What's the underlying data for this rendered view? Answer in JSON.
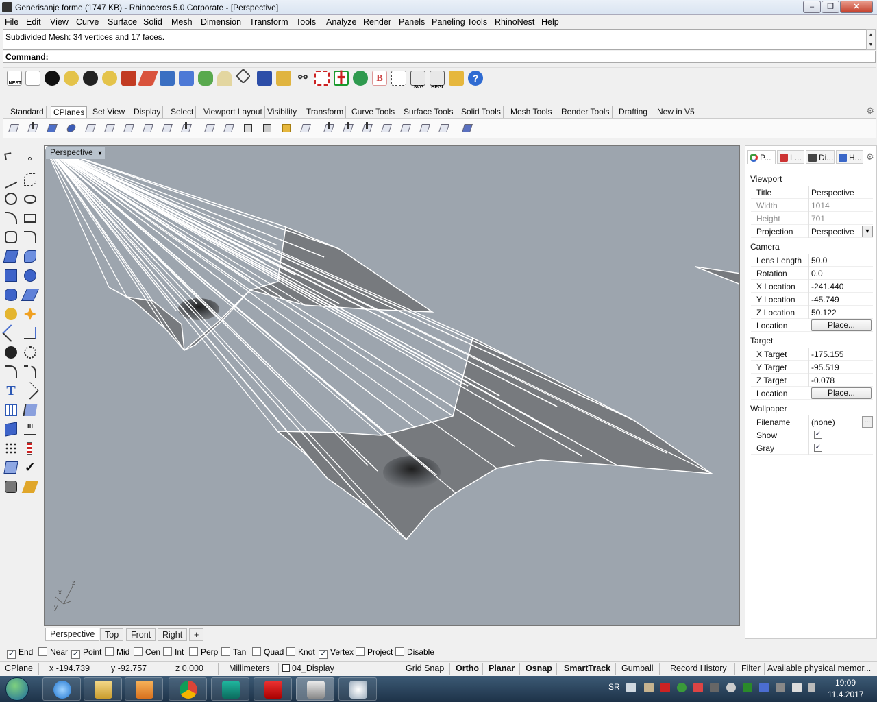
{
  "window": {
    "title": "Generisanje forme (1747 KB) - Rhinoceros  5.0 Corporate - [Perspective]",
    "controls": [
      "–",
      "❐",
      "✕"
    ]
  },
  "menu": [
    "File",
    "Edit",
    "View",
    "Curve",
    "Surface",
    "Solid",
    "Mesh",
    "Dimension",
    "Transform",
    "Tools",
    "Analyze",
    "Render",
    "Panels",
    "Paneling Tools",
    "RhinoNest",
    "Help"
  ],
  "command": {
    "history": "Subdivided Mesh: 34 vertices and 17 faces.",
    "prompt_label": "Command:"
  },
  "toolbar_top": {
    "nest_label": "NEST",
    "svg_label": "SVG",
    "hpgl_label": "HPGL",
    "b_label": "B",
    "help_label": "?"
  },
  "toolbar_tabs": [
    "Standard",
    "CPlanes",
    "Set View",
    "Display",
    "Select",
    "Viewport Layout",
    "Visibility",
    "Transform",
    "Curve Tools",
    "Surface Tools",
    "Solid Tools",
    "Mesh Tools",
    "Render Tools",
    "Drafting",
    "New in V5"
  ],
  "viewport": {
    "title": "Perspective",
    "axis_labels": {
      "x": "x",
      "y": "y",
      "z": "z"
    },
    "tabs": [
      "Perspective",
      "Top",
      "Front",
      "Right"
    ],
    "add_tab": "+",
    "background": "#9da5ae",
    "mesh_color": "#777a7e",
    "edge_color": "#ffffff"
  },
  "panel": {
    "tabs": [
      "P...",
      "L...",
      "Di...",
      "H..."
    ],
    "viewport_section": "Viewport",
    "viewport_rows": [
      {
        "key": "Title",
        "value": "Perspective"
      },
      {
        "key": "Width",
        "value": "1014"
      },
      {
        "key": "Height",
        "value": "701"
      },
      {
        "key": "Projection",
        "value": "Perspective"
      }
    ],
    "camera_section": "Camera",
    "camera_rows": [
      {
        "key": "Lens Length",
        "value": "50.0"
      },
      {
        "key": "Rotation",
        "value": "0.0"
      },
      {
        "key": "X Location",
        "value": "-241.440"
      },
      {
        "key": "Y Location",
        "value": "-45.749"
      },
      {
        "key": "Z Location",
        "value": "50.122"
      },
      {
        "key": "Location",
        "value": "Place..."
      }
    ],
    "target_section": "Target",
    "target_rows": [
      {
        "key": "X Target",
        "value": "-175.155"
      },
      {
        "key": "Y Target",
        "value": "-95.519"
      },
      {
        "key": "Z Target",
        "value": "-0.078"
      },
      {
        "key": "Location",
        "value": "Place..."
      }
    ],
    "wallpaper_section": "Wallpaper",
    "wallpaper_rows": [
      {
        "key": "Filename",
        "value": "(none)",
        "browse": "..."
      },
      {
        "key": "Show",
        "checked": true
      },
      {
        "key": "Gray",
        "checked": true
      }
    ]
  },
  "osnap": [
    {
      "label": "End",
      "checked": true
    },
    {
      "label": "Near",
      "checked": false
    },
    {
      "label": "Point",
      "checked": true
    },
    {
      "label": "Mid",
      "checked": false
    },
    {
      "label": "Cen",
      "checked": false
    },
    {
      "label": "Int",
      "checked": false
    },
    {
      "label": "Perp",
      "checked": false
    },
    {
      "label": "Tan",
      "checked": false
    },
    {
      "label": "Quad",
      "checked": false
    },
    {
      "label": "Knot",
      "checked": false
    },
    {
      "label": "Vertex",
      "checked": true
    },
    {
      "label": "Project",
      "checked": false
    },
    {
      "label": "Disable",
      "checked": false
    }
  ],
  "status": {
    "cplane": "CPlane",
    "x": "x -194.739",
    "y": "y -92.757",
    "z": "z 0.000",
    "units": "Millimeters",
    "layer": "04_Display",
    "grid_snap": "Grid Snap",
    "ortho": "Ortho",
    "planar": "Planar",
    "osnap": "Osnap",
    "smarttrack": "SmartTrack",
    "gumball": "Gumball",
    "record_history": "Record History",
    "filter": "Filter",
    "memory": "Available physical memor..."
  },
  "taskbar": {
    "language": "SR",
    "time": "19:09",
    "date": "11.4.2017"
  }
}
